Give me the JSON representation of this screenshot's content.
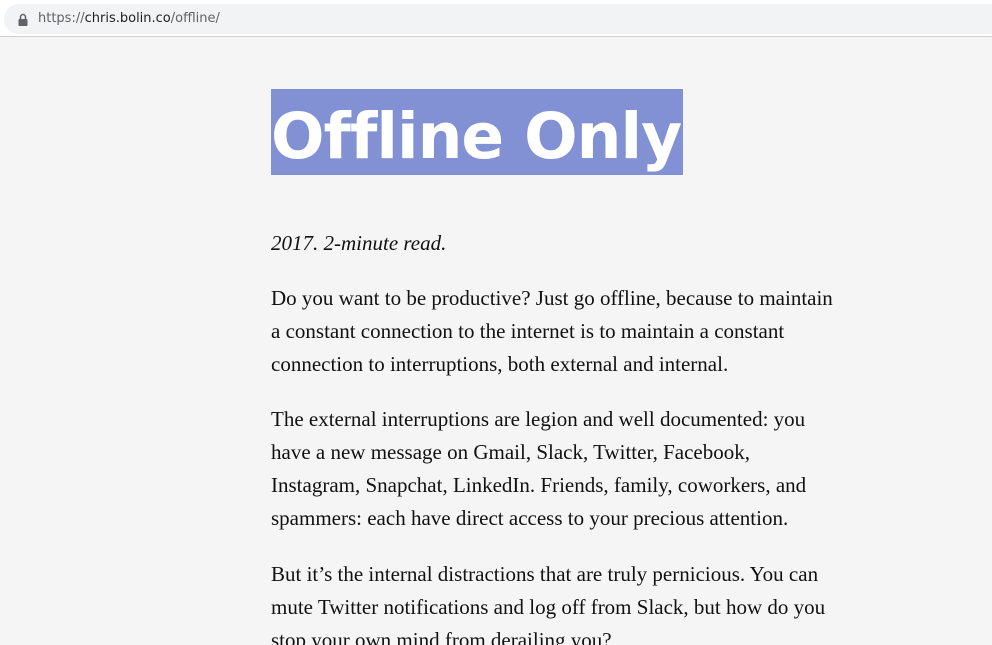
{
  "browser": {
    "url_scheme": "https://",
    "url_host": "chris.bolin.co",
    "url_path": "/offline/"
  },
  "article": {
    "title": "Offline Only",
    "meta": "2017. 2-minute read.",
    "paragraphs": [
      {
        "lines": [
          "Do you want to be productive? Just go offline, because to maintain",
          "a constant connection to the internet is to maintain a constant",
          "connection to interruptions, both external and internal."
        ]
      },
      {
        "lines": [
          "The external interruptions are legion and well documented: you",
          "have a new message on Gmail, Slack, Twitter, Facebook,",
          "Instagram, Snapchat, LinkedIn. Friends, family, coworkers, and",
          "spammers: each have direct access to your precious attention."
        ]
      },
      {
        "lines": [
          "But it’s the internal distractions that are truly pernicious. You can",
          "mute Twitter notifications and log off from Slack, but how do you",
          "stop your own mind from derailing you?"
        ]
      }
    ]
  },
  "colors": {
    "title_highlight": "#8290d4",
    "page_background": "#f5f5f5"
  }
}
